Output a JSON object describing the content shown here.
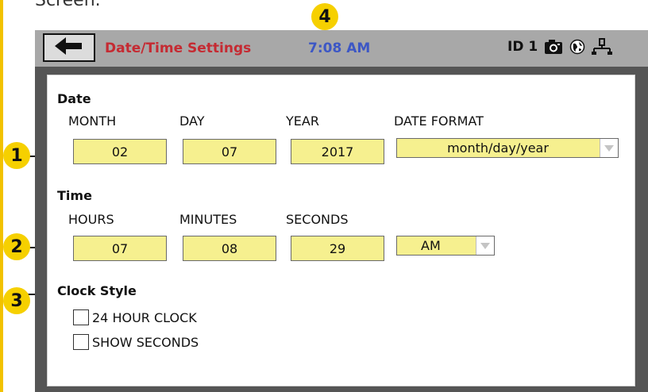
{
  "top_fragment": "Screen.",
  "callouts": {
    "c1": "1",
    "c2": "2",
    "c3": "3",
    "c4": "4"
  },
  "header": {
    "back_icon": "left-arrow-icon",
    "title": "Date/Time Settings",
    "clock": "7:08 AM",
    "id_label": "ID 1",
    "icons": [
      "camera-icon",
      "globe-icon",
      "network-icon"
    ]
  },
  "date": {
    "section": "Date",
    "month_label": "MONTH",
    "day_label": "DAY",
    "year_label": "YEAR",
    "format_label": "DATE FORMAT",
    "month": "02",
    "day": "07",
    "year": "2017",
    "format_value": "month/day/year"
  },
  "time": {
    "section": "Time",
    "hours_label": "HOURS",
    "minutes_label": "MINUTES",
    "seconds_label": "SECONDS",
    "hours": "07",
    "minutes": "08",
    "seconds": "29",
    "ampm": "AM"
  },
  "clock_style": {
    "section": "Clock Style",
    "option_24": "24 HOUR CLOCK",
    "option_seconds": "SHOW SECONDS",
    "checked_24": false,
    "checked_seconds": false
  },
  "colors": {
    "field_yellow": "#f6f08f",
    "callout_yellow": "#f6d000",
    "title_red": "#c52a32",
    "clock_blue": "#3d57c5"
  }
}
